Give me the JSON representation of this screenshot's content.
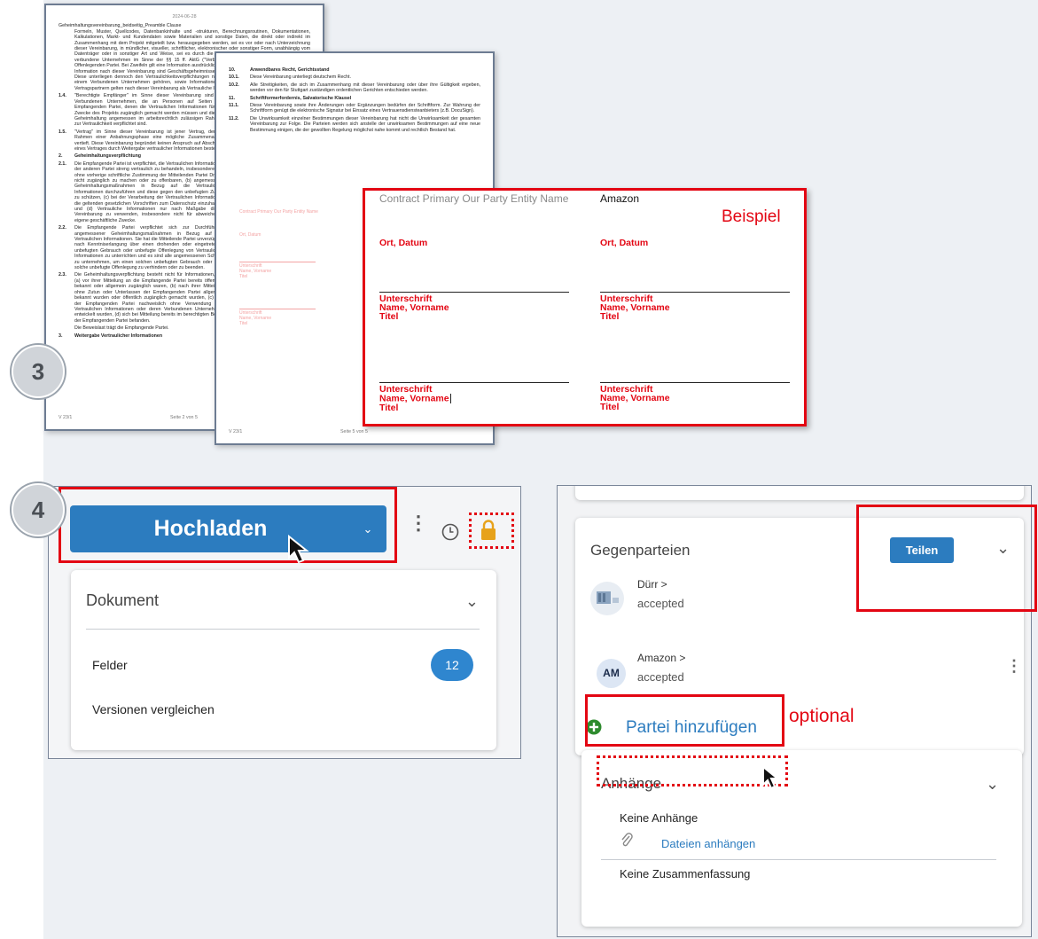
{
  "steps": {
    "step3": "3",
    "step4": "4"
  },
  "doc_page_1": {
    "date": "2024-06-28",
    "title": "Geheimhaltungsvereinbarung_beidseitig_Preamble Clause",
    "intro": "Formeln, Muster, Quellcodes, Datenbankinhalte und -strukturen, Berechnungsroutinen, Dokumentationen, Kalkulationen, Markt- und Kundendaten sowie Materialien und sonstige Daten, die direkt oder indirekt im Zusammenhang mit dem Projekt mitgeteilt bzw. herausgegeben werden, sei es vor oder nach Unterzeichnung dieser Vereinbarung, in mündlicher, visueller, schriftlicher, elektronischer oder sonstiger Form, unabhängig vom Datenträger oder in sonstiger Art und Weise, sei es durch die Offenlegende Partei oder durch Dritte oder verbundene Unternehmen im Sinne der §§ 15 ff. AktG (\"Verbundene Unternehmen\") auf Anweisung der Offenlegenden Partei. Bei Zweifeln gilt eine Information ausdrücklich als vertraulich gekennzeichnet. Vertrauliche Information nach dieser Vereinbarung sind Geschäftsgeheimnisse im Sinne des Geschäftsgeheimnisgesetzes. Diese unterliegen dennoch den Vertraulichkeitsverpflichtungen nach dieser Vereinbarung. Informationen, die einem Verbundenen Unternehmen gehören, sowie Informationen von Kunden, Lieferanten und sonstigen Vertragspartnern gelten nach dieser Vereinbarung als Vertrauliche Informationen der Partei.",
    "s14_num": "1.4.",
    "s14": "\"Berechtigte Empfänger\" im Sinne dieser Vereinbarung sind die Verbundenen Unternehmen, die an Personen auf Seiten der Empfangenden Partei, denen die Vertraulichen Informationen für die Zwecke des Projekts zugänglich gemacht werden müssen und die zur Geheimhaltung angemessen im arbeitsrechtlich zulässigen Rahmen zur Vertraulichkeit verpflichtet sind.",
    "s15_num": "1.5.",
    "s15": "\"Vertrag\" im Sinne dieser Vereinbarung ist jener Vertrag, der im Rahmen einer Anbahnungsphase eine mögliche Zusammenarbeit vertieft. Diese Vereinbarung begründet keinen Anspruch auf Abschluss eines Vertrages durch Weitergabe vertraulicher Informationen besteht.",
    "s2_num": "2.",
    "s2": "Geheimhaltungsverpflichtung",
    "s21_num": "2.1.",
    "s21": "Die Empfangende Partei ist verpflichtet, die Vertraulichen Informationen der anderen Partei streng vertraulich zu behandeln, insbesondere: (a) ohne vorherige schriftliche Zustimmung der Mitteilenden Partei Dritten nicht zugänglich zu machen oder zu offenbaren, (b) angemessene Geheimhaltungsmaßnahmen in Bezug auf die Vertraulichen Informationen durchzuführen und diese gegen den unbefugten Zugriff zu schützen, (c) bei der Verarbeitung der Vertraulichen Informationen die geltenden gesetzlichen Vorschriften zum Datenschutz einzuhalten, und (d) Vertrauliche Informationen nur nach Maßgabe dieser Vereinbarung zu verwenden, insbesondere nicht für abweichende eigene geschäftliche Zwecke.",
    "s22_num": "2.2.",
    "s22": "Die Empfangende Partei verpflichtet sich zur Durchführung angemessener Geheimhaltungsmaßnahmen in Bezug auf die Vertraulichen Informationen. Sie hat die Mitteilende Partei unverzüglich nach Kenntniserlangung über einen drohenden oder eingetretenen unbefugten Gebrauch oder unbefugte Offenlegung von Vertraulichen Informationen zu unterrichten und es sind alle angemessenen Schritte zu unternehmen, um einen solchen unbefugten Gebrauch oder eine solche unbefugte Offenlegung zu verhindern oder zu beenden.",
    "s23_num": "2.3.",
    "s23": "Die Geheimhaltungsverpflichtung besteht nicht für Informationen, die (a) vor ihrer Mitteilung an die Empfangende Partei bereits öffentlich bekannt oder allgemein zugänglich waren, (b) nach ihrer Mitteilung ohne Zutun oder Unterlassen der Empfangenden Partei allgemein bekannt wurden oder öffentlich zugänglich gemacht wurden, (c) von der Empfangenden Partei nachweislich ohne Verwendung von Vertraulichen Informationen oder deren Verbundenen Unternehmen entwickelt wurden, (d) sich bei Mitteilung bereits im berechtigten Besitz der Empfangenden Partei befanden.",
    "s23_tail": "Die Beweislast trägt die Empfangende Partei.",
    "s3_num": "3.",
    "s3": "Weitergabe Vertraulicher Informationen",
    "footer_left": "V 23/1",
    "footer_right": "Seite 2 von 5"
  },
  "doc_page_2": {
    "s10_num": "10.",
    "s10": "Anwendbares Recht, Gerichtsstand",
    "s101_num": "10.1.",
    "s101": "Diese Vereinbarung unterliegt deutschem Recht.",
    "s102_num": "10.2.",
    "s102": "Alle Streitigkeiten, die sich im Zusammenhang mit dieser Vereinbarung oder über ihre Gültigkeit ergeben, werden vor den für Stuttgart zuständigen ordentlichen Gerichten entschieden werden.",
    "s11_num": "11.",
    "s11": "Schriftformerfordernis, Salvatorische Klausel",
    "s111_num": "11.1.",
    "s111": "Diese Vereinbarung sowie ihre Änderungen oder Ergänzungen bedürfen der Schriftform. Zur Wahrung der Schriftform genügt die elektronische Signatur bei Einsatz eines Vertrauensdiensteanbieters (z.B. DocuSign).",
    "s112_num": "11.2.",
    "s112": "Die Unwirksamkeit einzelner Bestimmungen dieser Vereinbarung hat nicht die Unwirksamkeit der gesamten Vereinbarung zur Folge. Die Parteien werden sich anstelle der unwirksamen Bestimmungen auf eine neue Bestimmung einigen, die der gewollten Regelung möglichst nahe kommt und rechtlich Bestand hat.",
    "faded_header": "Contract Primary Our Party Entity Name",
    "faded_place": "Ort, Datum",
    "faded_sig1": "Unterschrift",
    "faded_name1": "Name, Vorname",
    "faded_title1": "Titel",
    "faded_sig2": "Unterschrift",
    "faded_name2": "Name, Vorname",
    "faded_title2": "Titel",
    "footer_left": "V 23/1",
    "footer_right": "Seite 5 von 5"
  },
  "signature_example": {
    "label": "Beispiel",
    "left_header": "Contract Primary Our Party Entity Name",
    "right_header": "Amazon",
    "left_place": "Ort, Datum",
    "right_place": "Ort, Datum",
    "left_sig1": "Unterschrift",
    "left_name1": "Name, Vorname",
    "left_title1": "Titel",
    "right_sig1": "Unterschrift",
    "right_name1": "Name, Vorname",
    "right_title1": "Titel",
    "left_sig2": "Unterschrift",
    "left_name2": "Name, Vorname",
    "left_title2": "Titel",
    "right_sig2": "Unterschrift",
    "right_name2": "Name, Vorname",
    "right_title2": "Titel"
  },
  "upload_panel": {
    "button_label": "Hochladen",
    "dropdown_title": "Dokument",
    "fields_label": "Felder",
    "fields_count": "12",
    "compare_label": "Versionen vergleichen"
  },
  "counterparties_panel": {
    "title": "Gegenparteien",
    "share_button": "Teilen",
    "parties": [
      {
        "name": "Dürr",
        "status": "accepted",
        "avatar": ""
      },
      {
        "name": "Amazon",
        "status": "accepted",
        "avatar": "AM"
      }
    ],
    "add_party": "Partei hinzufügen",
    "optional_label": "optional",
    "attachments_title": "Anhänge",
    "no_attachments": "Keine Anhänge",
    "attach_files": "Dateien anhängen",
    "no_summary": "Keine Zusammenfassung"
  },
  "colors": {
    "highlight_red": "#e30613",
    "primary_blue": "#2c7cbf",
    "badge_blue": "#2f86cf",
    "add_green": "#2e8b2e",
    "lock_gold": "#e7a21b"
  }
}
